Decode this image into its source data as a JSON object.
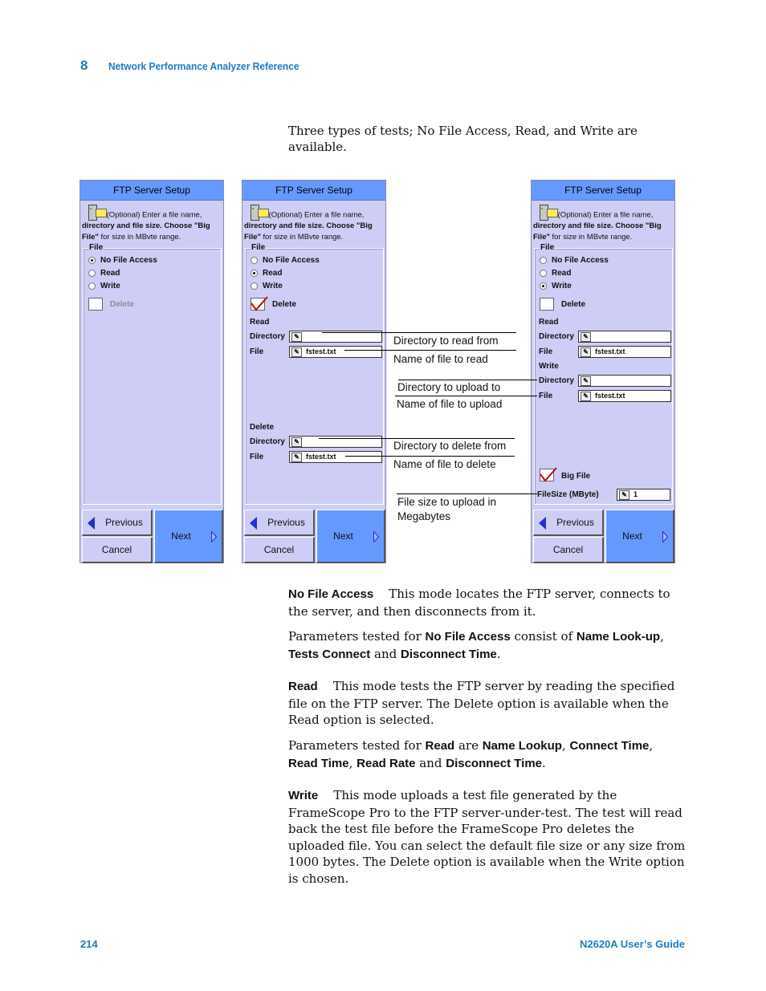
{
  "header": {
    "chapter": "8",
    "title": "Network Performance Analyzer Reference"
  },
  "intro": "Three types of tests; No File Access, Read, and Write are available.",
  "screen": {
    "title": "FTP Server Setup",
    "desc_line1": "(Optional) Enter a file name,",
    "desc_line2": "directory and file size.  Choose \"Big",
    "desc_line3_b": "File\"",
    "desc_line3": " for size in MBvte range.",
    "group_label": "File",
    "opt_no_file": "No File Access",
    "opt_read": "Read",
    "opt_write": "Write",
    "delete_label": "Delete",
    "read_section": "Read",
    "write_section": "Write",
    "delete_section": "Delete",
    "directory_label": "Directory",
    "file_label": "File",
    "file_value": "fstest.txt",
    "directory_value": "",
    "big_file_label": "Big File",
    "filesize_label": "FileSize (MByte)",
    "filesize_value": "1",
    "edit_icon": "pencil-edit-icon",
    "btn_previous": "Previous",
    "btn_next": "Next",
    "btn_cancel": "Cancel"
  },
  "panels": [
    {
      "mode": "No File Access",
      "delete_checked": false,
      "delete_enabled": false
    },
    {
      "mode": "Read",
      "delete_checked": true,
      "delete_enabled": true
    },
    {
      "mode": "Write",
      "delete_checked": false,
      "delete_enabled": true,
      "big_file_checked": true
    }
  ],
  "callouts": {
    "read_dir": "Directory to read from",
    "read_file": "Name of file to read",
    "upload_dir": "Directory to upload to",
    "upload_file": "Name of file to upload",
    "delete_dir": "Directory to delete from",
    "delete_file": "Name of file to delete",
    "filesize_1": "File size to upload in",
    "filesize_2": "Megabytes"
  },
  "sections": {
    "nofile_head": "No File Access",
    "nofile_text": "This mode locates the FTP server, connects to the server, and then disconnects from it.",
    "nofile_params_pre": "Parameters tested for ",
    "nofile_params_b1": "No File Access",
    "nofile_params_mid": " consist of ",
    "nofile_params_b2": "Name Look-up",
    "nofile_params_b3": "Tests Connect",
    "and": " and ",
    "nofile_params_b4": "Disconnect Time",
    "read_head": "Read",
    "read_text": "This mode tests the FTP server by reading the specified file on the FTP server. The Delete option is available when the Read option is selected.",
    "read_params_pre": "Parameters tested for ",
    "read_params_b1": "Read",
    "read_params_mid": " are ",
    "read_params_b2": "Name Lookup",
    "read_params_b3": "Connect Time",
    "read_params_b4": "Read Time",
    "read_params_b5": "Read Rate",
    "read_params_b6": "Disconnect Time",
    "write_head": "Write",
    "write_text": "This mode uploads a test file generated by the FrameScope Pro to the FTP server-under-test. The test will read back the test file before the FrameScope Pro deletes the uploaded file. You can select the default file size or any size from 1000 bytes. The Delete option is available when the Write option is chosen."
  },
  "footer": {
    "page": "214",
    "guide": "N2620A User’s Guide"
  }
}
